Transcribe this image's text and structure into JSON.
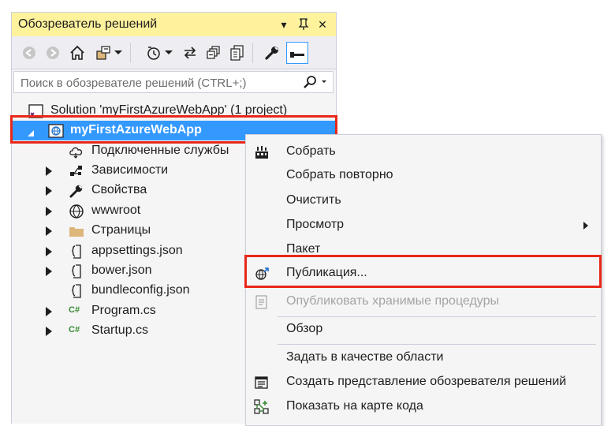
{
  "panel": {
    "title": "Обозреватель решений",
    "title_buttons": {
      "dropdown": "▾",
      "pin": "⊿",
      "close": "✕"
    }
  },
  "toolbar": {
    "items": [
      "back-icon",
      "forward-icon",
      "home-icon",
      "switch-views-icon",
      "dropdown-icon",
      "pending-changes-icon",
      "sync-icon",
      "collapse-all-icon",
      "show-all-files-icon",
      "properties-icon",
      "preview-icon"
    ]
  },
  "search": {
    "placeholder": "Поиск в обозревателе решений (CTRL+;)"
  },
  "tree": {
    "solution": "Solution 'myFirstAzureWebApp' (1 project)",
    "project": "myFirstAzureWebApp",
    "items": [
      {
        "label": "Подключенные службы",
        "icon": "connected-services-icon",
        "expandable": false
      },
      {
        "label": "Зависимости",
        "icon": "dependencies-icon",
        "expandable": true
      },
      {
        "label": "Свойства",
        "icon": "wrench-icon",
        "expandable": true
      },
      {
        "label": "wwwroot",
        "icon": "globe-icon",
        "expandable": true
      },
      {
        "label": "Страницы",
        "icon": "folder-icon",
        "expandable": true
      },
      {
        "label": "appsettings.json",
        "icon": "json-file-icon",
        "expandable": true
      },
      {
        "label": "bower.json",
        "icon": "json-file-icon",
        "expandable": true
      },
      {
        "label": "bundleconfig.json",
        "icon": "json-file-icon",
        "expandable": false
      },
      {
        "label": "Program.cs",
        "icon": "csharp-file-icon",
        "expandable": true
      },
      {
        "label": "Startup.cs",
        "icon": "csharp-file-icon",
        "expandable": true
      }
    ]
  },
  "menu": {
    "items": [
      {
        "label": "Собрать",
        "icon": "build-icon"
      },
      {
        "label": "Собрать повторно"
      },
      {
        "label": "Очистить"
      },
      {
        "label": "Просмотр",
        "submenu": true
      },
      {
        "label": "Пакет"
      },
      {
        "label": "Публикация...",
        "icon": "publish-globe-icon"
      },
      {
        "label": "Опубликовать хранимые процедуры",
        "icon": "publish-procedures-icon",
        "disabled": true
      },
      {
        "label": "Обзор"
      },
      {
        "label": "Задать в качестве области"
      },
      {
        "label": "Создать представление обозревателя решений",
        "icon": "new-view-icon"
      },
      {
        "label": "Показать на карте кода",
        "icon": "code-map-icon"
      }
    ]
  },
  "colors": {
    "title_bar": "#fff29d",
    "selection": "#3399ff",
    "highlight_box": "#e8281a",
    "csharp": "#388a34"
  }
}
